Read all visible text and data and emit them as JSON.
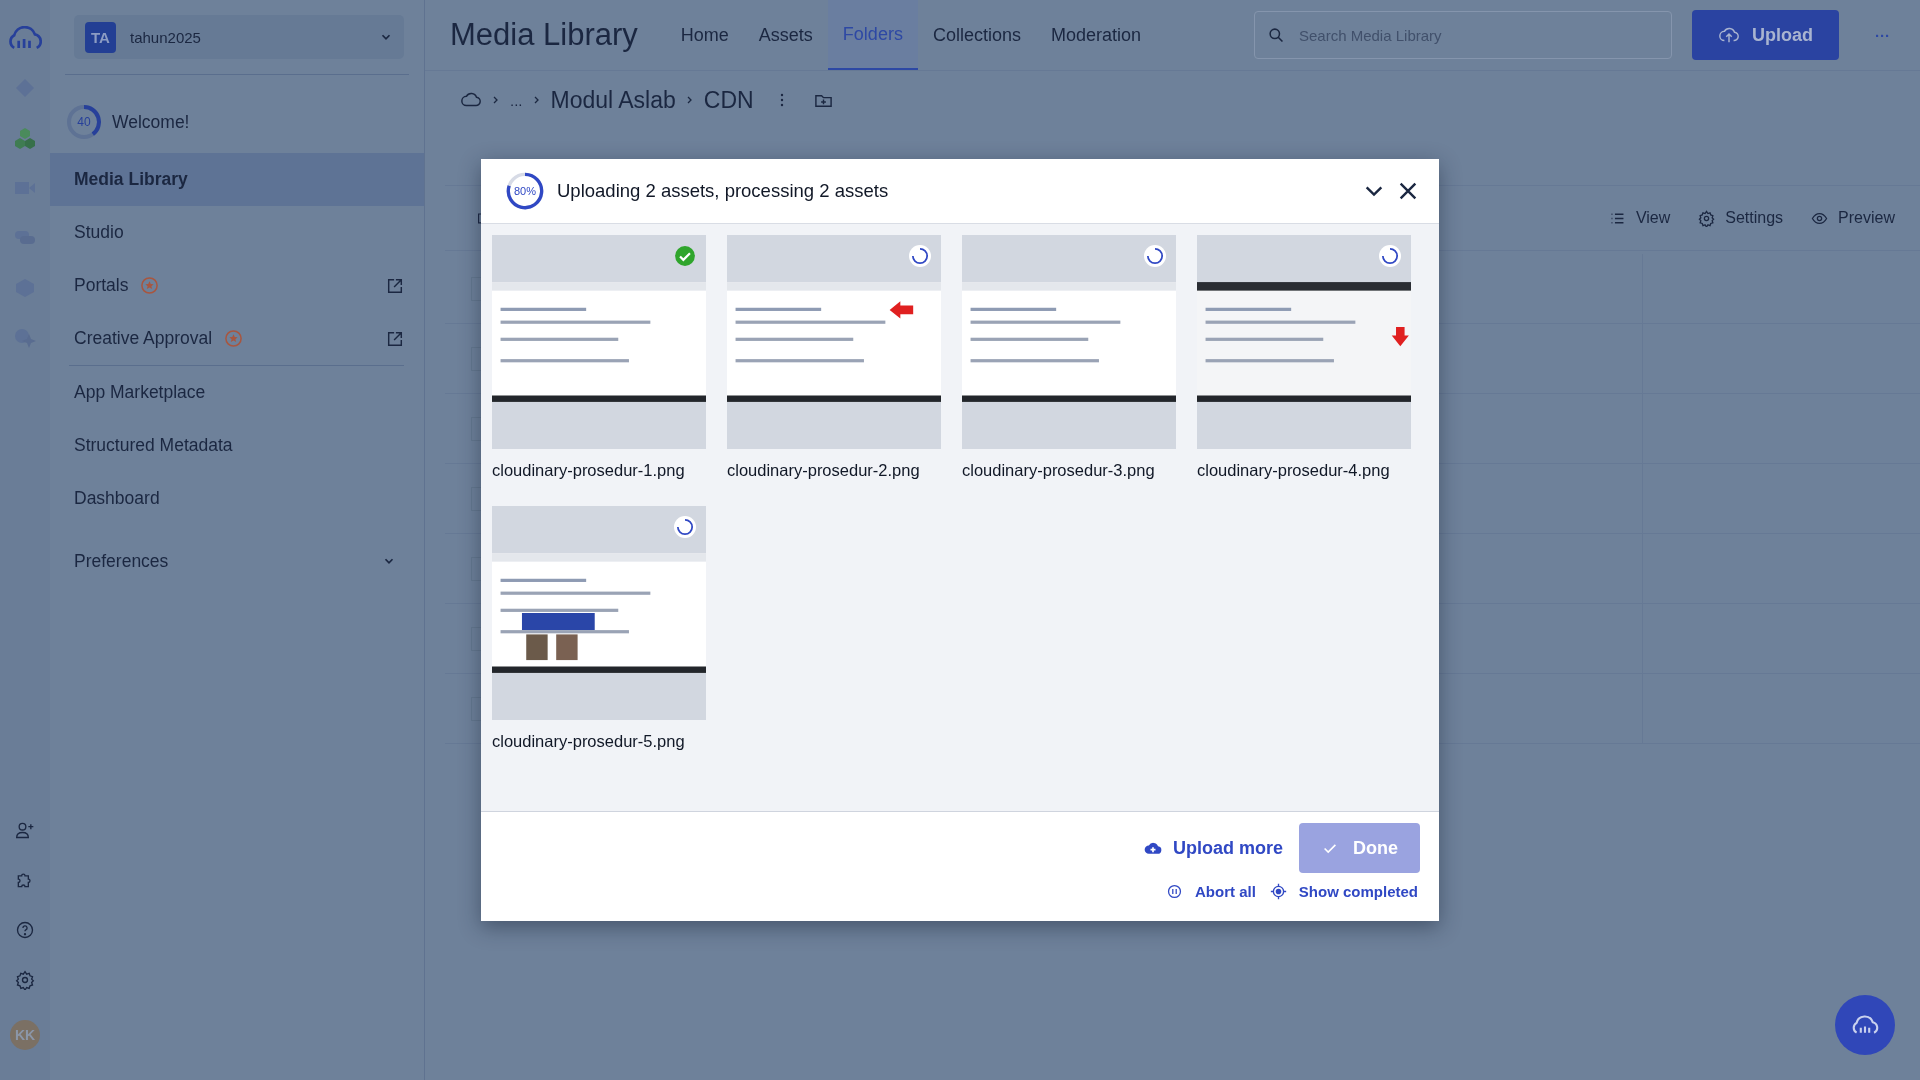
{
  "account": {
    "initials": "TA",
    "name": "tahun2025"
  },
  "welcome": {
    "progress": "40",
    "level": 0.4,
    "label": "Welcome!"
  },
  "sidebar": {
    "sections": [
      {
        "items": [
          {
            "label": "Media Library",
            "selected": true,
            "badge": false,
            "external": false
          },
          {
            "label": "Studio",
            "selected": false,
            "badge": false,
            "external": false
          },
          {
            "label": "Portals",
            "selected": false,
            "badge": true,
            "external": true
          },
          {
            "label": "Creative Approval",
            "selected": false,
            "badge": true,
            "external": true
          }
        ]
      },
      {
        "items": [
          {
            "label": "App Marketplace",
            "selected": false,
            "badge": false,
            "external": false
          },
          {
            "label": "Structured Metadata",
            "selected": false,
            "badge": false,
            "external": false
          },
          {
            "label": "Dashboard",
            "selected": false,
            "badge": false,
            "external": false
          }
        ]
      }
    ],
    "preferences": {
      "label": "Preferences",
      "expanded": false
    }
  },
  "user": {
    "initials": "KK"
  },
  "header": {
    "title": "Media Library",
    "tabs": [
      {
        "label": "Home",
        "selected": false
      },
      {
        "label": "Assets",
        "selected": false
      },
      {
        "label": "Folders",
        "selected": true
      },
      {
        "label": "Collections",
        "selected": false
      },
      {
        "label": "Moderation",
        "selected": false
      }
    ],
    "search": {
      "placeholder": "Search Media Library"
    },
    "upload": "Upload",
    "more": "···"
  },
  "breadcrumb": [
    {
      "label": "...",
      "kind": "ellipsis"
    },
    {
      "label": "Modul Aslab",
      "kind": "folder"
    },
    {
      "label": "CDN",
      "kind": "folder"
    }
  ],
  "toolbar": [
    "View",
    "Settings",
    "Preview"
  ],
  "rows": [
    {
      "checked": false
    },
    {
      "checked": false
    },
    {
      "checked": false
    },
    {
      "checked": false
    },
    {
      "checked": false
    },
    {
      "checked": false
    },
    {
      "checked": false
    }
  ],
  "dialog": {
    "progress": "80%",
    "level": 0.8,
    "title": "Uploading 2 assets, processing 2 assets",
    "files": [
      {
        "name": "cloudinary-prosedur-1.png",
        "completed": true
      },
      {
        "name": "cloudinary-prosedur-2.png",
        "completed": false
      },
      {
        "name": "cloudinary-prosedur-3.png",
        "completed": false
      },
      {
        "name": "cloudinary-prosedur-4.png",
        "completed": false
      },
      {
        "name": "cloudinary-prosedur-5.png",
        "completed": false
      }
    ],
    "upload_more": "Upload more",
    "done": {
      "label": "Done",
      "disabled": true
    },
    "abort": "Abort all",
    "show_completed": "Show completed"
  }
}
